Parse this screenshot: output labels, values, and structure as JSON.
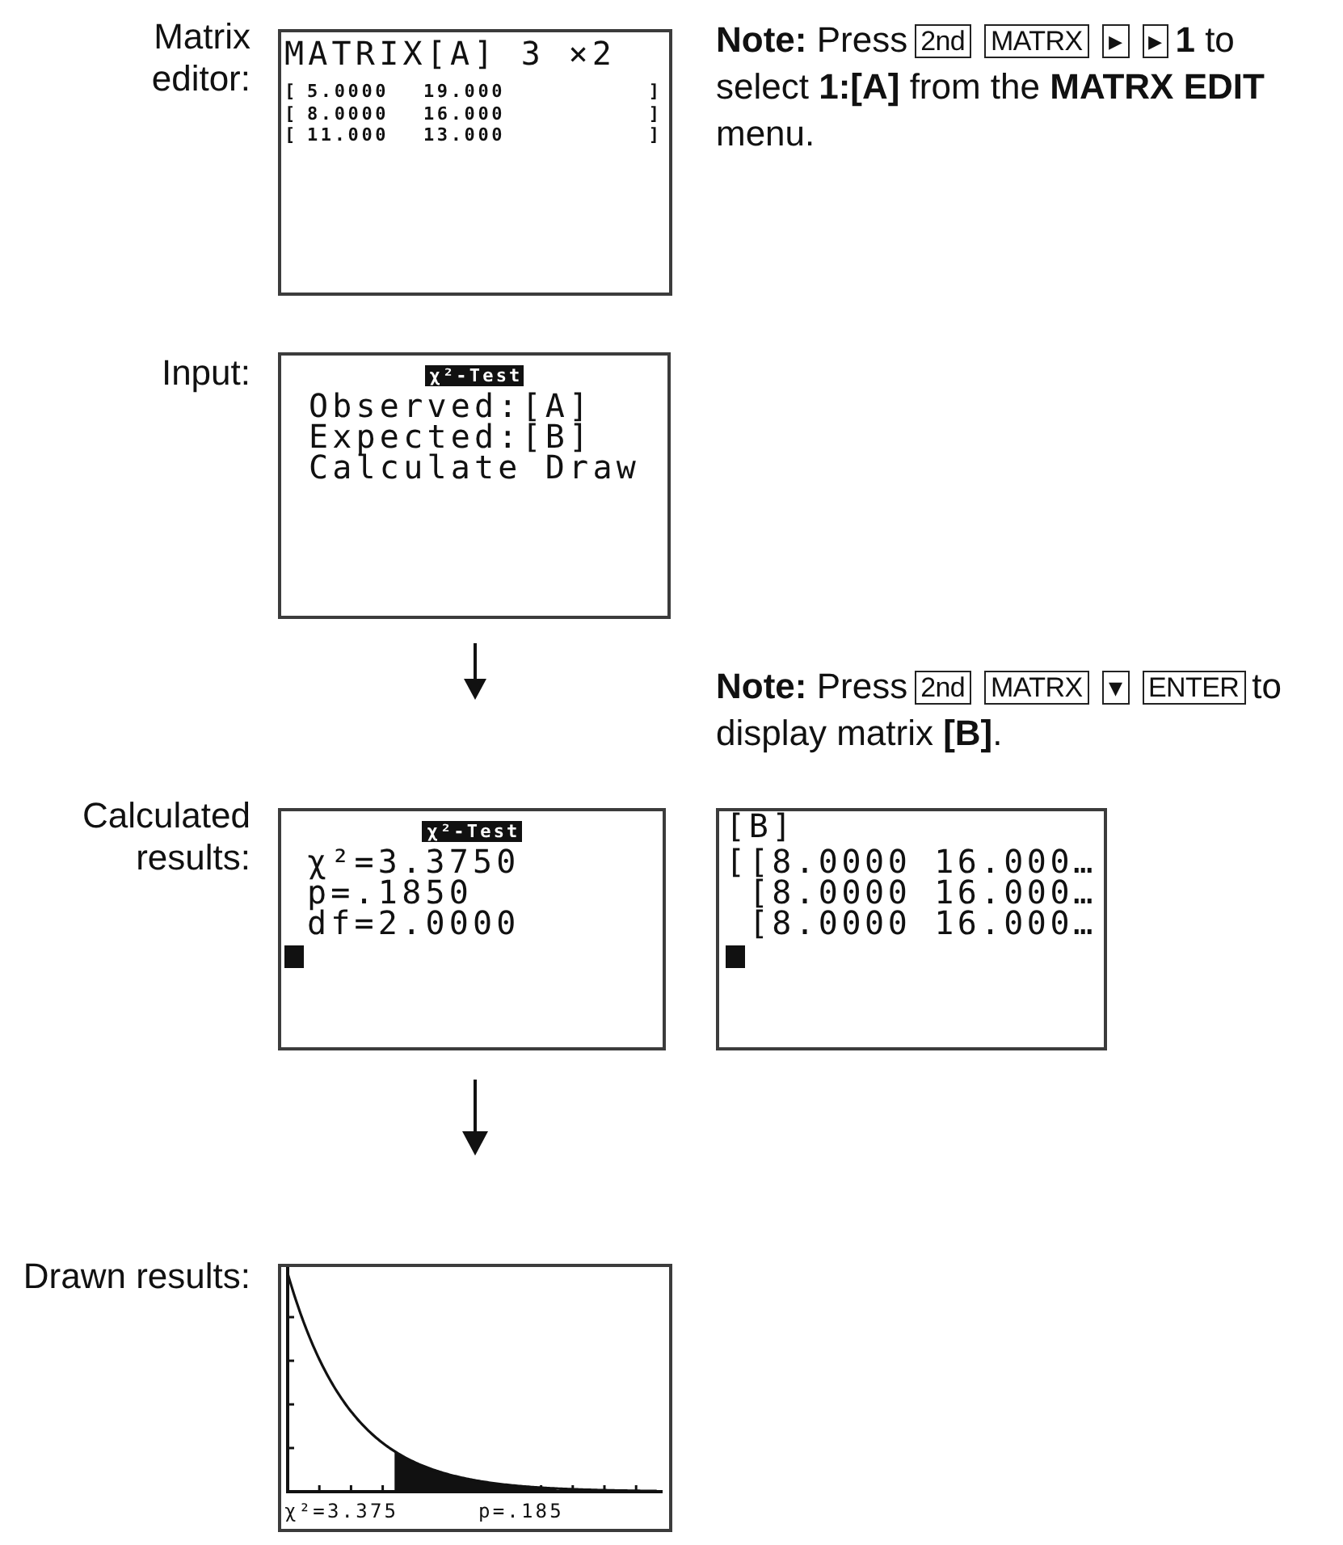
{
  "matrix_editor": {
    "label": "Matrix editor:",
    "screen": {
      "title": "MATRIX[A] 3 ×2",
      "rows": [
        {
          "open": "[",
          "values": [
            "5.0000",
            "19.000"
          ],
          "close": "]"
        },
        {
          "open": "[",
          "values": [
            "8.0000",
            "16.000"
          ],
          "close": "]"
        },
        {
          "open": "[",
          "values": [
            "11.000",
            "13.000"
          ],
          "close": "]"
        }
      ]
    },
    "note": {
      "segments": [
        {
          "kind": "text",
          "text": "**Note:** Press"
        },
        {
          "kind": "key",
          "text": "2nd"
        },
        {
          "kind": "key",
          "text": "MATRX"
        },
        {
          "kind": "key",
          "text": "▸"
        },
        {
          "kind": "key",
          "text": "▸"
        },
        {
          "kind": "text",
          "text": "**1** to select **1:[A]** from the **MATRX EDIT** menu."
        }
      ]
    }
  },
  "input": {
    "label": "Input:",
    "screen": {
      "header": "χ²-Test",
      "lines": [
        "Observed:[A]",
        "Expected:[B]",
        "Calculate Draw"
      ]
    }
  },
  "note_matrix_b": {
    "segments": [
      {
        "kind": "text",
        "text": "**Note:** Press"
      },
      {
        "kind": "key",
        "text": "2nd"
      },
      {
        "kind": "key",
        "text": "MATRX"
      },
      {
        "kind": "key",
        "text": "▾"
      },
      {
        "kind": "key",
        "text": "ENTER"
      },
      {
        "kind": "text",
        "text": "to display matrix **[B]**."
      }
    ]
  },
  "calculated_results": {
    "label": "Calculated results:",
    "screen": {
      "header": "χ²-Test",
      "lines": [
        "χ²=3.3750",
        "p=.1850",
        "df=2.0000"
      ],
      "cursor": true
    },
    "matrix_screen": {
      "title": "[B]",
      "outer_bracket": "[",
      "rows": [
        "[8.0000 16.000…",
        "[8.0000 16.000…",
        "[8.0000 16.000…"
      ],
      "cursor": true
    }
  },
  "drawn_results": {
    "label": "Drawn results:",
    "screen": {
      "statistic": "χ²=3.375",
      "p_value": "p=.185"
    }
  }
}
